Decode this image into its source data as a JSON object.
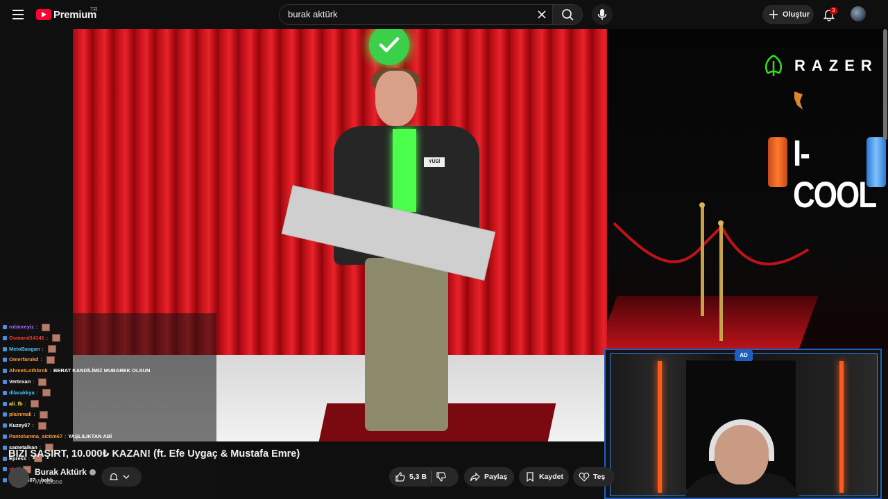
{
  "header": {
    "logo_text": "Premium",
    "logo_country": "TR",
    "search_value": "burak aktürk",
    "create_label": "Oluştur",
    "notification_count": "3"
  },
  "video": {
    "name_tag": "YÜSİ",
    "sponsor_razer": "RAZER",
    "sponsor_icool": "I-COOL",
    "webcam_badge": "AD"
  },
  "chat": {
    "messages": [
      {
        "user": "robinreyiz",
        "sep": ":",
        "msg": "",
        "color": "#b26bff"
      },
      {
        "user": "Osmand14141",
        "sep": ":",
        "msg": "",
        "color": "#ff3b3b"
      },
      {
        "user": "MetoBasgan",
        "sep": ":",
        "msg": "",
        "color": "#4fc3f7"
      },
      {
        "user": "Omerfarukd",
        "sep": ":",
        "msg": "",
        "color": "#ff9a3c"
      },
      {
        "user": "AhmetLothbrok",
        "sep": ":",
        "msg": "BERAT KANDİLİMİZ MUBAREK OLSUN",
        "color": "#ff9a3c"
      },
      {
        "user": "Vertexan",
        "sep": ":",
        "msg": "",
        "color": "#ffffff"
      },
      {
        "user": "dilarakkya",
        "sep": ":",
        "msg": "",
        "color": "#4fc3f7"
      },
      {
        "user": "ali_fb",
        "sep": ":",
        "msg": "",
        "color": "#ffe24a"
      },
      {
        "user": "plainmali",
        "sep": ":",
        "msg": "",
        "color": "#ff9a3c"
      },
      {
        "user": "Kuzey07",
        "sep": ":",
        "msg": "",
        "color": "#ffffff"
      },
      {
        "user": "Pantolunma_sictim67",
        "sep": ":",
        "msg": "YAŞLILIKTAN ABİ",
        "color": "#ff9a3c"
      },
      {
        "user": "sametalkan",
        "sep": ":",
        "msg": "",
        "color": "#ffffff"
      },
      {
        "user": "Epress",
        "sep": ":",
        "msg": "",
        "color": "#ffffff"
      },
      {
        "user": "sh",
        "sep": ":",
        "msg": "",
        "color": "#ff3b3b"
      },
      {
        "user": "Burak2307",
        "sep": ":",
        "msg": "haklı",
        "color": "#ffffff"
      }
    ]
  },
  "meta": {
    "title": "BİZİ ŞAŞIRT, 10.000₺ KAZAN! (ft. Efe Uygaç & Mustafa Emre)",
    "channel_name": "Burak Aktürk",
    "subscribers": "Mn abone",
    "like_count": "5,3 B",
    "share_label": "Paylaş",
    "save_label": "Kaydet",
    "thanks_label": "Teş"
  }
}
